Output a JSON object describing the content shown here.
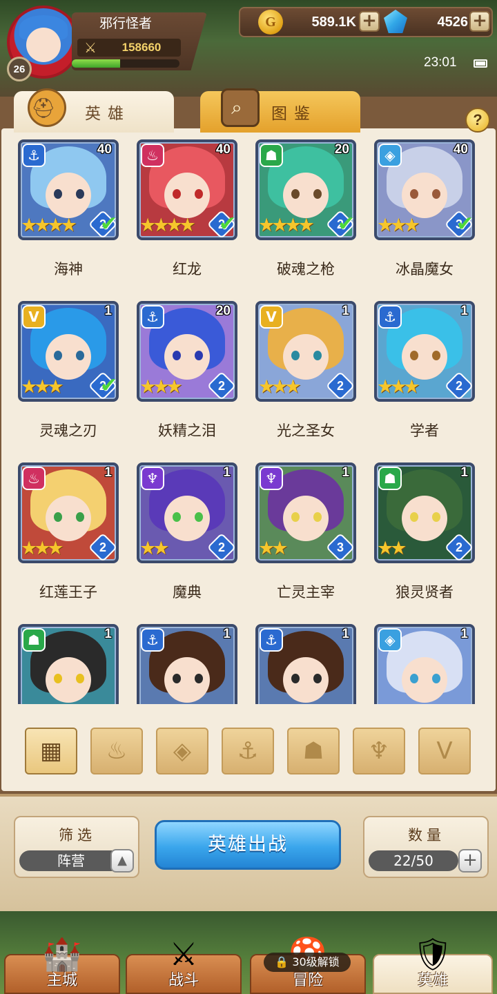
{
  "player": {
    "name": "邪行怪者",
    "level": "26",
    "power": "158660",
    "xp_fraction": 0.45
  },
  "currency": {
    "gold": "589.1K",
    "gems": "4526"
  },
  "status": {
    "time": "23:01"
  },
  "tabs": [
    {
      "label": "英雄",
      "icon": "helmet-icon",
      "active": true
    },
    {
      "label": "图鉴",
      "icon": "magnifier-icon",
      "active": false
    }
  ],
  "help": {
    "label": "?"
  },
  "heroes": [
    {
      "name": "海神",
      "level": "40",
      "faction": "anchor",
      "faction_color": "#2a6ad0",
      "stars": "★★★★",
      "rank": "2",
      "checked": true,
      "hair": "#8fc8f0",
      "eye": "#2a3a5a",
      "bg": "#4e78c0"
    },
    {
      "name": "红龙",
      "level": "40",
      "faction": "flame",
      "faction_color": "#d03060",
      "stars": "★★★★",
      "rank": "2",
      "checked": true,
      "hair": "#e85860",
      "eye": "#c02a2a",
      "bg": "#b83a40"
    },
    {
      "name": "破魂之枪",
      "level": "20",
      "faction": "beast",
      "faction_color": "#2aa84a",
      "stars": "★★★★",
      "rank": "2",
      "checked": true,
      "hair": "#3ec0a0",
      "eye": "#6a4a2a",
      "bg": "#3a9a7a"
    },
    {
      "name": "冰晶魔女",
      "level": "40",
      "faction": "crystal",
      "faction_color": "#3aa0e0",
      "stars": "★★★",
      "rank": "3",
      "checked": true,
      "hair": "#c8d0e8",
      "eye": "#9a5a3a",
      "bg": "#8a96c8"
    },
    {
      "name": "灵魂之刃",
      "level": "1",
      "faction": "light",
      "faction_color": "#e8b020",
      "stars": "★★★",
      "rank": "2",
      "checked": true,
      "hair": "#2a9ae8",
      "eye": "#2a6a9a",
      "bg": "#3a6ac0"
    },
    {
      "name": "妖精之泪",
      "level": "20",
      "faction": "anchor",
      "faction_color": "#2a6ad0",
      "stars": "★★★",
      "rank": "2",
      "checked": false,
      "hair": "#3a5ad8",
      "eye": "#2a3ab0",
      "bg": "#9a7ad8"
    },
    {
      "name": "光之圣女",
      "level": "1",
      "faction": "light",
      "faction_color": "#e8b020",
      "stars": "★★★",
      "rank": "2",
      "checked": false,
      "hair": "#e8b04a",
      "eye": "#2a8aa0",
      "bg": "#8aa6d8"
    },
    {
      "name": "学者",
      "level": "1",
      "faction": "anchor",
      "faction_color": "#2a6ad0",
      "stars": "★★★",
      "rank": "2",
      "checked": false,
      "hair": "#3ac0e8",
      "eye": "#a06a2a",
      "bg": "#5aa6d0"
    },
    {
      "name": "红莲王子",
      "level": "1",
      "faction": "flame",
      "faction_color": "#d03060",
      "stars": "★★★",
      "rank": "2",
      "checked": false,
      "hair": "#f4d070",
      "eye": "#3aa04a",
      "bg": "#c04a3a"
    },
    {
      "name": "魔典",
      "level": "1",
      "faction": "shadow",
      "faction_color": "#7a3ad0",
      "stars": "★★",
      "rank": "2",
      "checked": false,
      "hair": "#5a3ab8",
      "eye": "#4ac04a",
      "bg": "#6a5ab0"
    },
    {
      "name": "亡灵主宰",
      "level": "1",
      "faction": "shadow",
      "faction_color": "#7a3ad0",
      "stars": "★★",
      "rank": "3",
      "checked": false,
      "hair": "#6a3a9a",
      "eye": "#e8d04a",
      "bg": "#5a8a5a"
    },
    {
      "name": "狼灵贤者",
      "level": "1",
      "faction": "beast",
      "faction_color": "#2aa84a",
      "stars": "★★",
      "rank": "2",
      "checked": false,
      "hair": "#3a6a3a",
      "eye": "#e8d04a",
      "bg": "#2a5a3a"
    },
    {
      "name": "",
      "level": "1",
      "faction": "beast",
      "faction_color": "#2aa84a",
      "stars": "",
      "rank": "",
      "checked": false,
      "hair": "#2a2a2a",
      "eye": "#e8c020",
      "bg": "#3a8a9a"
    },
    {
      "name": "",
      "level": "1",
      "faction": "anchor",
      "faction_color": "#2a6ad0",
      "stars": "",
      "rank": "",
      "checked": false,
      "hair": "#4a2a1a",
      "eye": "#2a2a2a",
      "bg": "#5a7ab0"
    },
    {
      "name": "",
      "level": "1",
      "faction": "anchor",
      "faction_color": "#2a6ad0",
      "stars": "",
      "rank": "",
      "checked": false,
      "hair": "#4a2a1a",
      "eye": "#2a2a2a",
      "bg": "#5a7ab0"
    },
    {
      "name": "",
      "level": "1",
      "faction": "crystal",
      "faction_color": "#3aa0e0",
      "stars": "",
      "rank": "",
      "checked": false,
      "hair": "#d8e0f4",
      "eye": "#3aa0d0",
      "bg": "#7a9ad8"
    }
  ],
  "filters": [
    {
      "icon": "grid-all-icon",
      "glyph": "▦",
      "active": true
    },
    {
      "icon": "flame-faction-icon",
      "glyph": "♨",
      "active": false
    },
    {
      "icon": "crystal-faction-icon",
      "glyph": "◈",
      "active": false
    },
    {
      "icon": "anchor-faction-icon",
      "glyph": "⚓",
      "active": false
    },
    {
      "icon": "beast-faction-icon",
      "glyph": "☗",
      "active": false
    },
    {
      "icon": "shadow-faction-icon",
      "glyph": "♆",
      "active": false
    },
    {
      "icon": "light-faction-icon",
      "glyph": "V",
      "active": false
    }
  ],
  "controls": {
    "filter_title": "筛选",
    "filter_value": "阵营",
    "deploy_label": "英雄出战",
    "count_title": "数量",
    "count_value": "22/50"
  },
  "nav": [
    {
      "label": "主城",
      "icon": "castle-icon",
      "active": false
    },
    {
      "label": "战斗",
      "icon": "crossed-swords-icon",
      "active": false
    },
    {
      "label": "冒险",
      "icon": "adventure-icon",
      "active": false
    },
    {
      "label": "英雄",
      "icon": "hero-crest-icon",
      "active": true
    }
  ],
  "lock_text": "30级解锁"
}
